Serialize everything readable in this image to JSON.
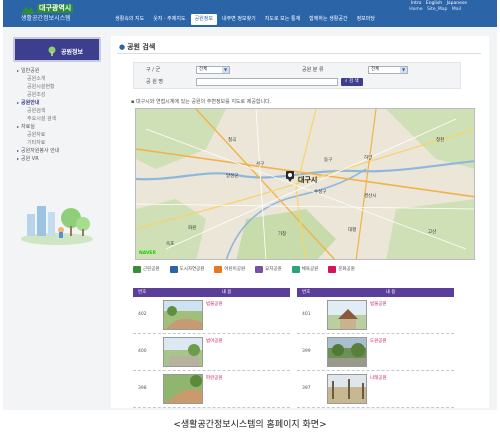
{
  "header": {
    "city": "대구광역시",
    "system_name": "생활공간정보시스템",
    "util_links": [
      "Intro",
      "English",
      "Japanese"
    ],
    "util_links2": [
      "Home",
      "Site_Map",
      "Mail"
    ],
    "gnb": [
      "생활속의 지도",
      "웃지 · 주제지도",
      "공원정보",
      "내주변 정보찾기",
      "지도로 보는 통계",
      "함께하는 생활공간",
      "정보마당"
    ],
    "gnb_active_index": 2
  },
  "sidebar": {
    "title": "공원정보",
    "menu": [
      {
        "label": "일반공원",
        "level": "top",
        "hi": false
      },
      {
        "label": "공원소개",
        "level": "sub",
        "hi": false
      },
      {
        "label": "공원시설현황",
        "level": "sub",
        "hi": false
      },
      {
        "label": "공원조성",
        "level": "sub",
        "hi": false
      },
      {
        "label": "공원안내",
        "level": "top",
        "hi": true
      },
      {
        "label": "공원검색",
        "level": "sub",
        "hi": false
      },
      {
        "label": "주요시설 검색",
        "level": "sub",
        "hi": false
      },
      {
        "label": "자료실",
        "level": "top",
        "hi": false
      },
      {
        "label": "공원자료",
        "level": "sub",
        "hi": false
      },
      {
        "label": "기타자료",
        "level": "sub",
        "hi": false
      },
      {
        "label": "공원자원봉사 안내",
        "level": "top",
        "hi": false
      },
      {
        "label": "공원 VR",
        "level": "top",
        "hi": false
      }
    ]
  },
  "main": {
    "title": "공원 검색",
    "search": {
      "district_label": "구 / 군",
      "district_value": "전체",
      "category_label": "공원 분 류",
      "category_value": "전체",
      "name_label": "공 원 명",
      "name_placeholder": "",
      "button_label": "검 색"
    },
    "notice": "대구시와 연접시계에 있는 공원의 주변정보를 지도로 제공합니다.",
    "map": {
      "city_label": "대구시",
      "places": [
        "칠곡",
        "서구",
        "달성군",
        "동구",
        "수성구",
        "경산시",
        "하양",
        "청천",
        "고산",
        "화원",
        "가창",
        "옥포",
        "대평"
      ],
      "provider": "NAVER"
    },
    "legend": [
      {
        "label": "근린공원",
        "color": "#3a8e3a"
      },
      {
        "label": "도시자연공원",
        "color": "#2c64a8"
      },
      {
        "label": "어린이공원",
        "color": "#e87722"
      },
      {
        "label": "묘지공원",
        "color": "#7b4fa6"
      },
      {
        "label": "체육공원",
        "color": "#2aa37a"
      },
      {
        "label": "문화공원",
        "color": "#d4145a"
      }
    ],
    "results": {
      "col_number": "번호",
      "col_content": "내 용",
      "left": [
        {
          "number": "402",
          "name": "범물공원"
        },
        {
          "number": "400",
          "name": "범어공원"
        },
        {
          "number": "398",
          "name": "파란공원"
        }
      ],
      "right": [
        {
          "number": "401",
          "name": "범물공원"
        },
        {
          "number": "399",
          "name": "도원공원"
        },
        {
          "number": "397",
          "name": "나래공원"
        }
      ]
    }
  },
  "caption": "<생활공간정보시스템의 홈페이지 화면>"
}
